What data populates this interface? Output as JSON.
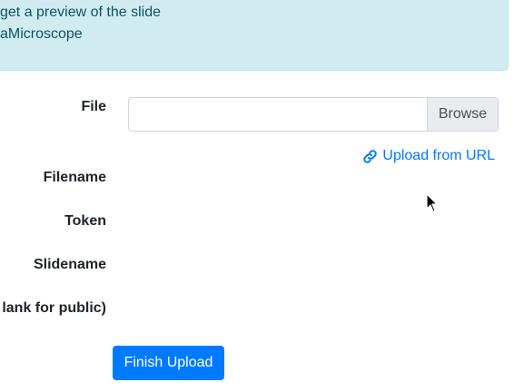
{
  "info": {
    "line1": "get a preview of the slide",
    "line2": "aMicroscope"
  },
  "form": {
    "file_label": "File",
    "file_input_value": "",
    "browse_label": "Browse",
    "upload_url_label": "Upload from URL",
    "filename_label": "Filename",
    "token_label": "Token",
    "slidename_label": "Slidename",
    "public_label": "lank for public)",
    "finish_label": "Finish Upload"
  },
  "icons": {
    "upload_url": "link-icon",
    "pointer": "mouse-cursor-icon"
  },
  "colors": {
    "info_bg": "#d1ecf1",
    "info_text": "#0c5460",
    "primary": "#007bff",
    "browse_bg": "#e9ecef"
  }
}
